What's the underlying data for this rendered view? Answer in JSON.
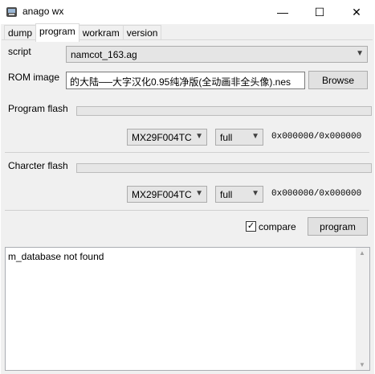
{
  "window": {
    "title": "anago wx",
    "icon": "wrench-icon",
    "minimize": "—",
    "maximize": "☐",
    "close": "✕"
  },
  "tabs": [
    "dump",
    "program",
    "workram",
    "version"
  ],
  "script": {
    "label": "script",
    "value": "namcot_163.ag"
  },
  "rom": {
    "label": "ROM image",
    "value": "的大陆──大字汉化0.95纯净版(全动画非全头像).nes",
    "browse": "Browse"
  },
  "program_flash": {
    "label": "Program flash",
    "progress": 0,
    "device": "MX29F004TC",
    "mode": "full",
    "counter": "0x000000/0x000000"
  },
  "charcter_flash": {
    "label": "Charcter flash",
    "progress": 0,
    "device": "MX29F004TC",
    "mode": "full",
    "counter": "0x000000/0x000000"
  },
  "compare": {
    "label": "compare",
    "checked": true,
    "check_glyph": "✓"
  },
  "program_button": "program",
  "log": {
    "text": "m_database not found"
  }
}
